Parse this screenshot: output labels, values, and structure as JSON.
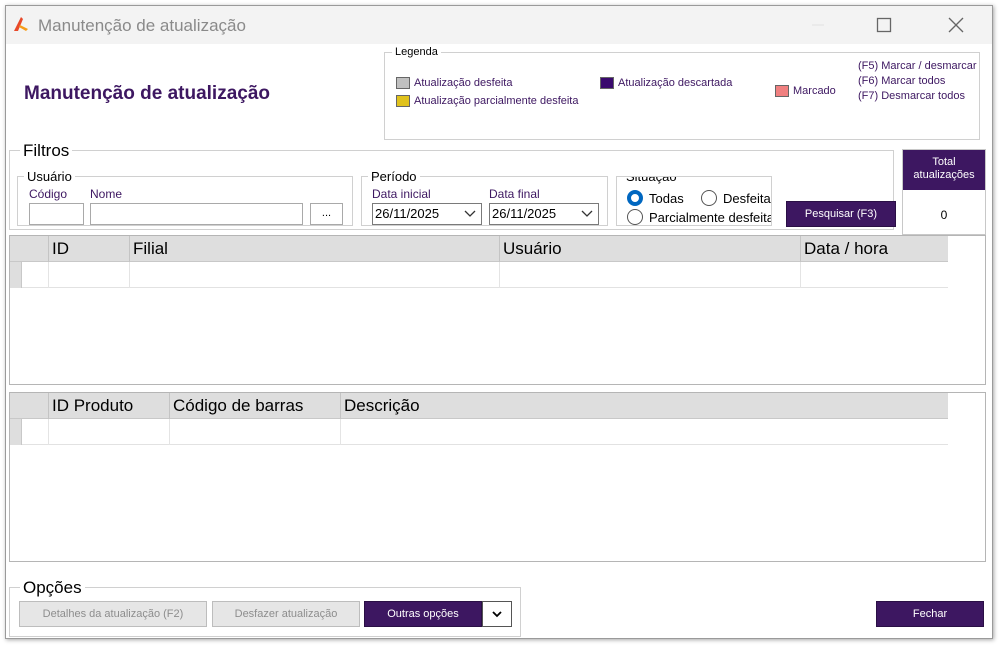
{
  "window": {
    "title": "Manutenção de atualização"
  },
  "page": {
    "heading": "Manutenção de atualização"
  },
  "legend": {
    "title": "Legenda",
    "items": [
      {
        "label": "Atualização desfeita",
        "color": "#c0c0c0"
      },
      {
        "label": "Atualização parcialmente desfeita",
        "color": "#e0c21c"
      },
      {
        "label": "Atualização descartada",
        "color": "#3a0a6e"
      },
      {
        "label": "Marcado",
        "color": "#f08080"
      }
    ],
    "shortcuts": [
      "(F5) Marcar / desmarcar",
      "(F6) Marcar todos",
      "(F7) Desmarcar todos"
    ]
  },
  "filters": {
    "title": "Filtros",
    "usuario": {
      "title": "Usuário",
      "codigo_label": "Código",
      "nome_label": "Nome",
      "codigo_value": "",
      "nome_value": "",
      "lookup_label": "..."
    },
    "periodo": {
      "title": "Período",
      "inicial_label": "Data inicial",
      "final_label": "Data final",
      "inicial_value": "26/11/2025",
      "final_value": "26/11/2025"
    },
    "situacao": {
      "title": "Situação",
      "options": [
        "Todas",
        "Desfeita",
        "Parcialmente desfeita"
      ],
      "selected": "Todas"
    },
    "search_button": "Pesquisar (F3)"
  },
  "total": {
    "label": "Total atualizações",
    "value": "0"
  },
  "updates_grid": {
    "columns": [
      "ID",
      "Filial",
      "Usuário",
      "Data / hora"
    ],
    "rows": []
  },
  "products_grid": {
    "columns": [
      "ID Produto",
      "Código de barras",
      "Descrição"
    ],
    "rows": []
  },
  "options": {
    "title": "Opções",
    "details_button": "Detalhes da atualização (F2)",
    "undo_button": "Desfazer atualização",
    "other_button": "Outras opções"
  },
  "close_button": "Fechar",
  "accent_color": "#3d1761"
}
